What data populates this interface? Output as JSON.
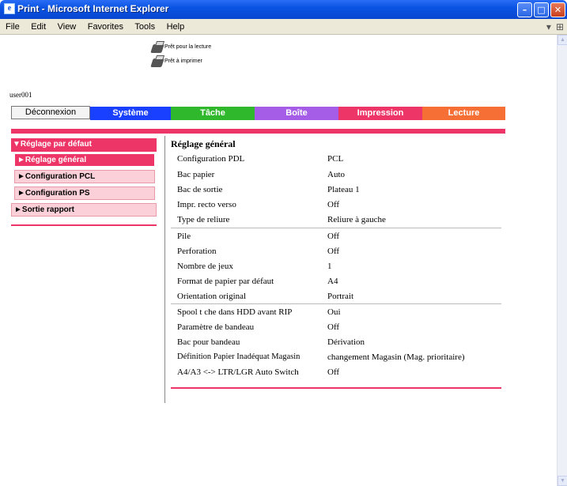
{
  "window": {
    "title": "Print - Microsoft Internet Explorer",
    "app_icon": "ie-icon"
  },
  "menu": [
    "File",
    "Edit",
    "View",
    "Favorites",
    "Tools",
    "Help"
  ],
  "status": {
    "ready_read": "Prêt pour la lecture",
    "ready_print": "Prêt à imprimer"
  },
  "user": "user001",
  "logout_label": "Déconnexion",
  "tabs": [
    {
      "label": "Système",
      "color": "#1a40ff"
    },
    {
      "label": "Tâche",
      "color": "#2fb82b"
    },
    {
      "label": "Boîte",
      "color": "#a55de8"
    },
    {
      "label": "Impression",
      "color": "#ed3567"
    },
    {
      "label": "Lecture",
      "color": "#f66f35"
    }
  ],
  "sidebar": [
    {
      "label": "▼Réglage par défaut"
    },
    {
      "label": "►Réglage général"
    },
    {
      "label": "►Configuration PCL"
    },
    {
      "label": "►Configuration PS"
    },
    {
      "label": "►Sortie rapport"
    }
  ],
  "section_title": "Réglage général",
  "settings": [
    {
      "label": "Configuration PDL",
      "value": "PCL"
    },
    {
      "label": "Bac papier",
      "value": "Auto"
    },
    {
      "label": "Bac de sortie",
      "value": "Plateau 1"
    },
    {
      "label": "Impr. recto verso",
      "value": "Off"
    },
    {
      "label": "Type de reliure",
      "value": "Reliure à gauche"
    },
    {
      "label": "Pile",
      "value": "Off"
    },
    {
      "label": "Perforation",
      "value": "Off"
    },
    {
      "label": "Nombre de jeux",
      "value": "1"
    },
    {
      "label": "Format de papier par défaut",
      "value": "A4"
    },
    {
      "label": "Orientation original",
      "value": "Portrait"
    },
    {
      "label": "Spool t che dans HDD avant RIP",
      "value": "Oui"
    },
    {
      "label": "Paramètre de bandeau",
      "value": "Off"
    },
    {
      "label": "Bac pour bandeau",
      "value": "Dérivation"
    },
    {
      "label": "Définition Papier Inadéquat Magasin",
      "value": "changement Magasin (Mag. prioritaire)"
    },
    {
      "label": "A4/A3 <-> LTR/LGR Auto Switch",
      "value": "Off"
    }
  ]
}
